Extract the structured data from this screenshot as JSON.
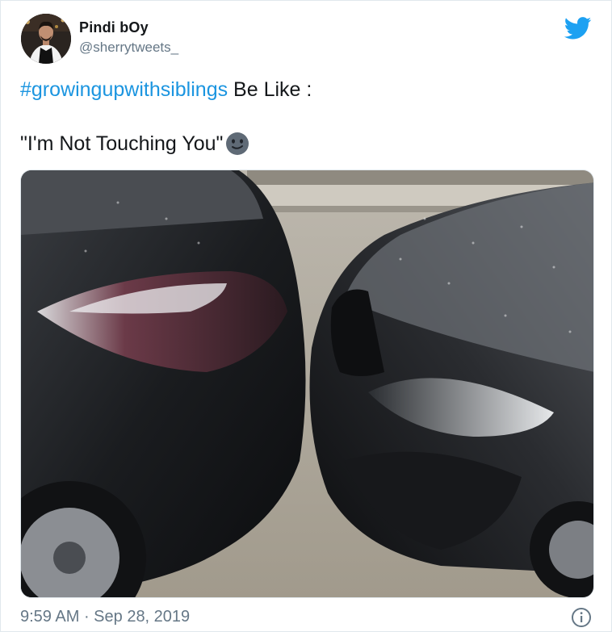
{
  "user": {
    "display_name": "Pindi bOy",
    "handle": "@sherrytweets_",
    "avatar_icon": "profile-photo"
  },
  "tweet": {
    "hashtag": "#growingupwithsiblings",
    "line1_rest": " Be Like :",
    "line2": "\"I'm Not Touching You\"",
    "emoji": "smirking-face-emoji"
  },
  "media": {
    "description_icon": "two-black-cars-touching-photo"
  },
  "footer": {
    "time": "9:59 AM",
    "separator": " · ",
    "date": "Sep 28, 2019"
  },
  "colors": {
    "link": "#1b95e0",
    "text": "#14171a",
    "muted": "#657786",
    "twitter_blue": "#1da1f2"
  }
}
